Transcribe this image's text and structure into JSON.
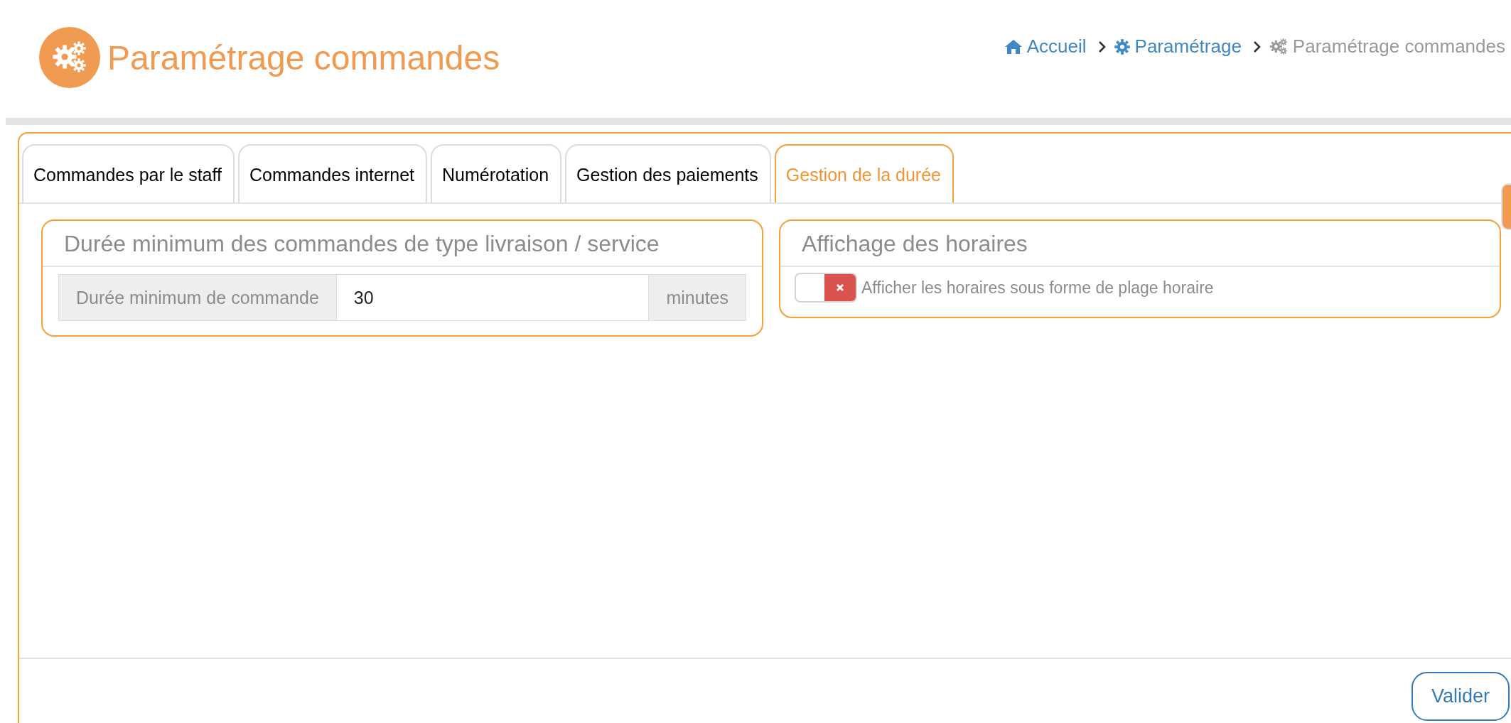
{
  "page_title": "Paramétrage commandes",
  "breadcrumb": [
    {
      "label": "Accueil",
      "kind": "home",
      "current": false
    },
    {
      "label": "Paramétrage",
      "kind": "settings",
      "current": false
    },
    {
      "label": "Paramétrage commandes",
      "kind": "page",
      "current": true
    }
  ],
  "tabs": [
    {
      "label": "Commandes par le staff",
      "selected": false
    },
    {
      "label": "Commandes internet",
      "selected": false
    },
    {
      "label": "Numérotation",
      "selected": false
    },
    {
      "label": "Gestion des paiements",
      "selected": false
    },
    {
      "label": "Gestion de la durée",
      "selected": true
    }
  ],
  "panels": [
    {
      "title": "Durée minimum des commandes de type livraison / service",
      "kind": "input_group",
      "label": "Durée minimum de commande",
      "value": "30",
      "unit": "minutes"
    },
    {
      "title": "Affichage des horaires",
      "kind": "switch",
      "label": "Afficher les horaires sous forme de plage horaire",
      "on": false
    }
  ],
  "buttons": [
    "Valider"
  ]
}
